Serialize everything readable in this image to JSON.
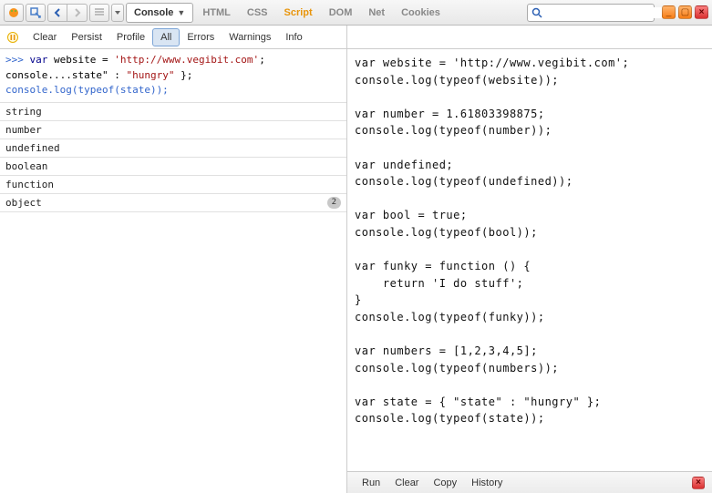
{
  "topbar": {
    "tabs": {
      "console": "Console",
      "html": "HTML",
      "css": "CSS",
      "script": "Script",
      "dom": "DOM",
      "net": "Net",
      "cookies": "Cookies"
    },
    "search_placeholder": ""
  },
  "subbar": {
    "clear": "Clear",
    "persist": "Persist",
    "profile": "Profile",
    "all": "All",
    "errors": "Errors",
    "warnings": "Warnings",
    "info": "Info"
  },
  "console_input": {
    "prompt": ">>>",
    "line1_a": "var",
    "line1_b": " website = ",
    "line1_c": "'http://www.vegibit.com'",
    "line1_d": ";",
    "line2_a": "console....state\"",
    "line2_b": " : ",
    "line2_c": "\"hungry\"",
    "line2_d": " };",
    "line3": "console.log(typeof(state));"
  },
  "console_output": [
    {
      "text": "string",
      "count": null
    },
    {
      "text": "number",
      "count": null
    },
    {
      "text": "undefined",
      "count": null
    },
    {
      "text": "boolean",
      "count": null
    },
    {
      "text": "function",
      "count": null
    },
    {
      "text": "object",
      "count": "2"
    }
  ],
  "code": "var website = 'http://www.vegibit.com';\nconsole.log(typeof(website));\n\nvar number = 1.61803398875;\nconsole.log(typeof(number));\n\nvar undefined;\nconsole.log(typeof(undefined));\n\nvar bool = true;\nconsole.log(typeof(bool));\n\nvar funky = function () {\n    return 'I do stuff';\n}\nconsole.log(typeof(funky));\n\nvar numbers = [1,2,3,4,5];\nconsole.log(typeof(numbers));\n\nvar state = { \"state\" : \"hungry\" };\nconsole.log(typeof(state));",
  "footer": {
    "run": "Run",
    "clear": "Clear",
    "copy": "Copy",
    "history": "History"
  }
}
